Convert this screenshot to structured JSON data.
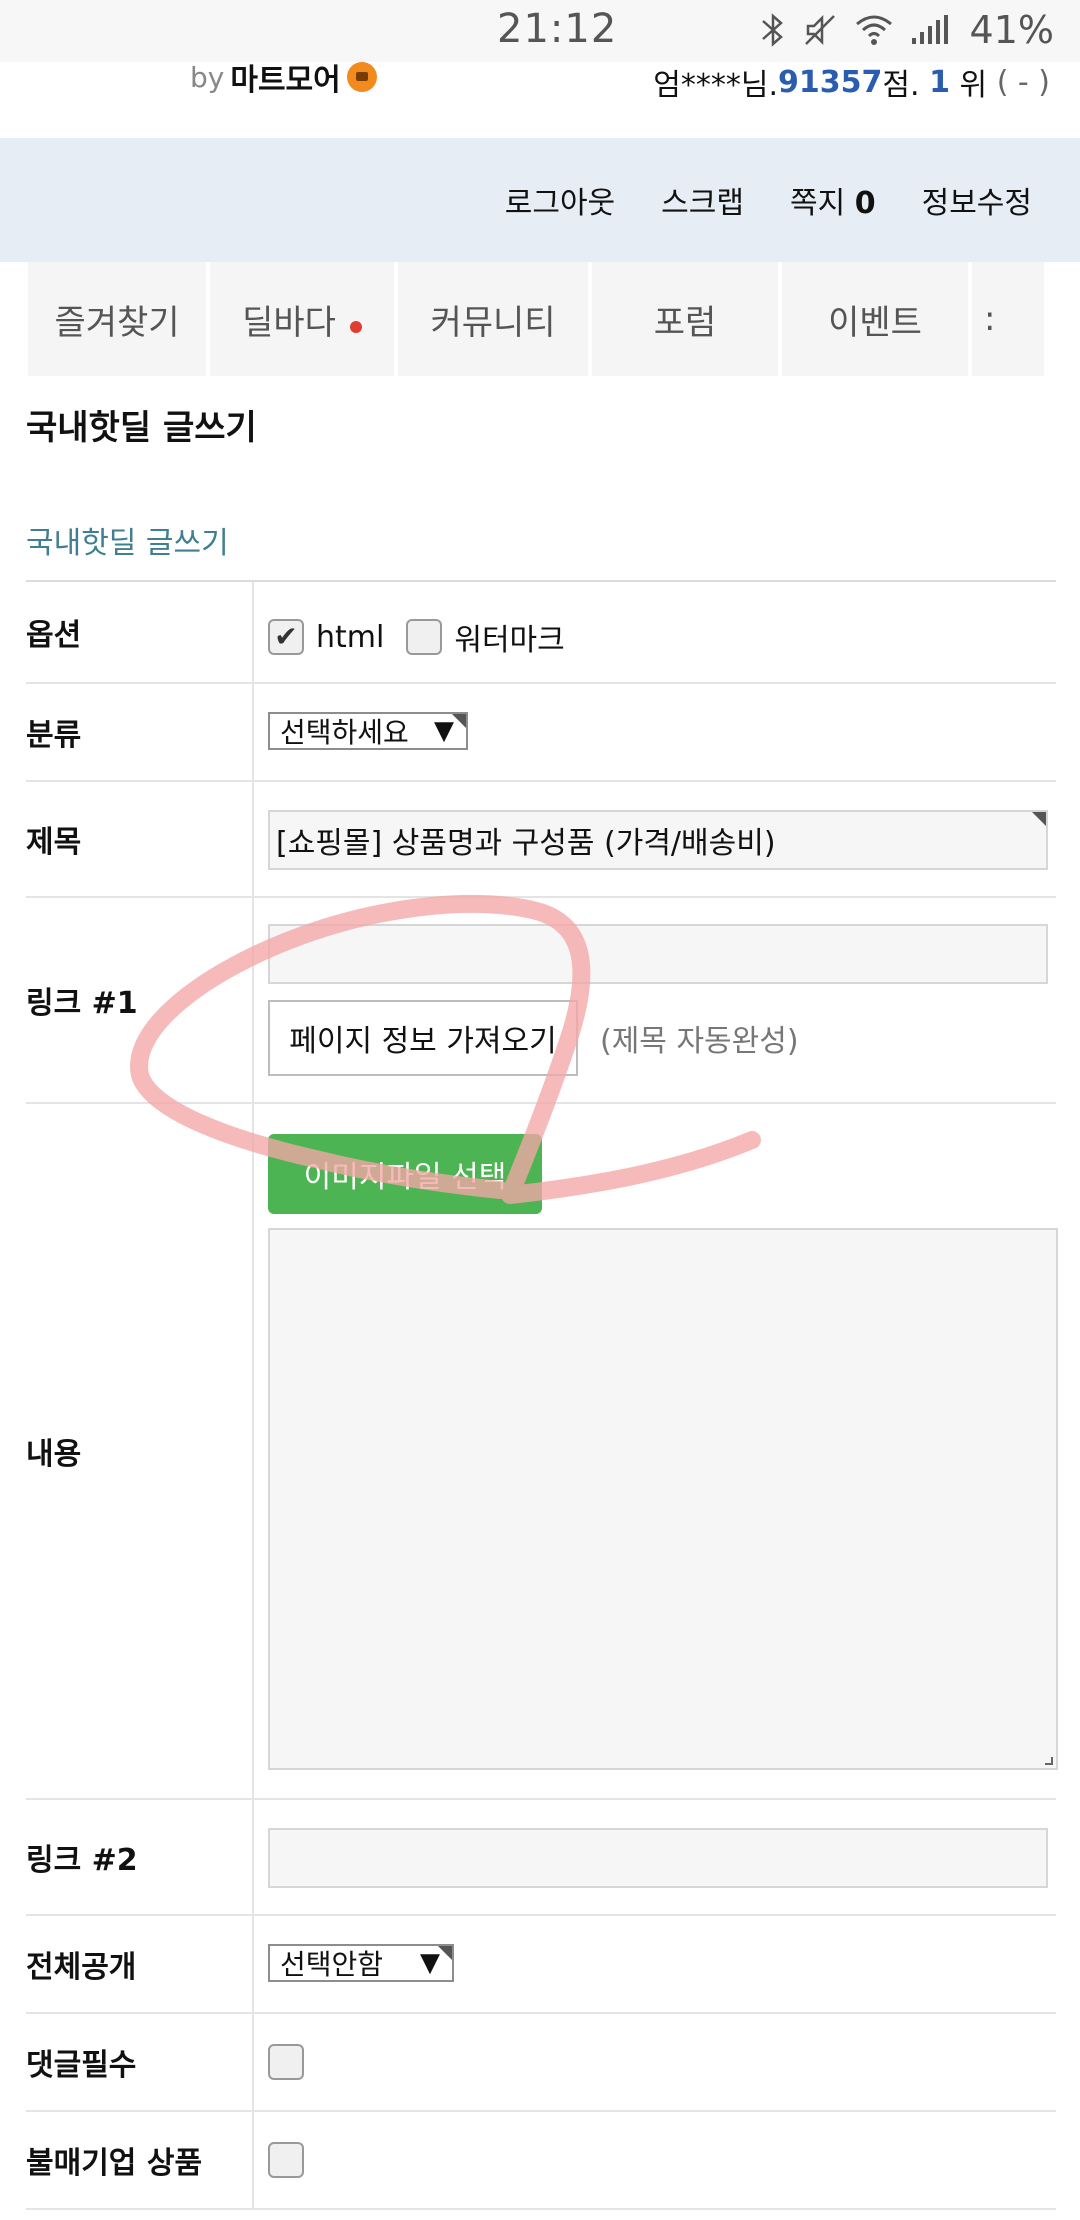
{
  "status": {
    "time": "21:12",
    "battery": "41%"
  },
  "header": {
    "brand_by": "by",
    "brand_name": "마트모어",
    "user_name": "엄****님.",
    "points": "91357",
    "points_suffix": "점.",
    "rank": "1",
    "rank_suffix": "위",
    "rank_change": "( - )"
  },
  "actions": {
    "logout": "로그아웃",
    "scrap": "스크랩",
    "message": "쪽지",
    "message_count": "0",
    "edit_info": "정보수정"
  },
  "nav": {
    "tabs": [
      "즐겨찾기",
      "딜바다",
      "커뮤니티",
      "포럼",
      "이벤트",
      ":"
    ]
  },
  "page": {
    "title": "국내핫딜 글쓰기",
    "section": "국내핫딜 글쓰기"
  },
  "form": {
    "options_label": "옵션",
    "opt_html": "html",
    "opt_html_checked": true,
    "opt_watermark": "워터마크",
    "opt_watermark_checked": false,
    "category_label": "분류",
    "category_value": "선택하세요",
    "subject_label": "제목",
    "subject_value": "[쇼핑몰] 상품명과 구성품 (가격/배송비)",
    "link1_label": "링크 #1",
    "link1_value": "",
    "fetch_button": "페이지 정보 가져오기",
    "fetch_hint": "(제목 자동완성)",
    "content_label": "내용",
    "image_button": "이미지파일 선택",
    "content_value": "",
    "link2_label": "링크 #2",
    "link2_value": "",
    "public_label": "전체공개",
    "public_value": "선택안함",
    "comment_required_label": "댓글필수",
    "comment_required_checked": false,
    "boycott_label": "불매기업 상품",
    "boycott_checked": false
  },
  "colors": {
    "accent_blue": "#2a5db0",
    "section_teal": "#3f7f8f",
    "green_button": "#4cb452",
    "action_bar": "#e7edf4",
    "annotation": "#f4a6a6"
  }
}
